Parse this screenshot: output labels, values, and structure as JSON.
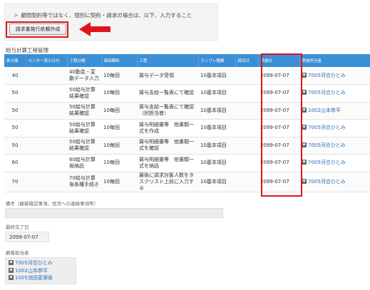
{
  "notice": {
    "text": "顧問契約等ではなく、個別に契約・請求の場合は、以下、入力すること",
    "button_label": "請求書発行依頼作成"
  },
  "section_title": "給与計算工程管理",
  "table": {
    "headers": [
      "表示順",
      "カンダー表示日付",
      "工程分類",
      "毎回類時",
      "工程",
      "テンプレ種類",
      "締切日",
      "実施日",
      "実施担当者"
    ],
    "rows": [
      {
        "order": "40",
        "calendar": "",
        "category": "40勤怠・変動データ入力",
        "frequency": "10毎回",
        "process": "賃与データ受領",
        "template": "10基本項目",
        "deadline": "",
        "done_date": "2099-07-07",
        "staff": "7005河合ひとみ"
      },
      {
        "order": "50",
        "calendar": "",
        "category": "50給与計算結果確認",
        "frequency": "10毎回",
        "process": "賃与支給一覧表にて確認",
        "template": "10基本項目",
        "deadline": "",
        "done_date": "2099-07-07",
        "staff": "7005河合ひとみ"
      },
      {
        "order": "50",
        "calendar": "",
        "category": "50給与計算結果確認",
        "frequency": "10毎回",
        "process": "賃与支給一覧表にて確認（別担当者）",
        "template": "10基本項目",
        "deadline": "",
        "done_date": "2099-07-07",
        "staff": "1002山本恭平"
      },
      {
        "order": "50",
        "calendar": "",
        "category": "50給与計算結果確認",
        "frequency": "10毎回",
        "process": "賃与明細書等　他書類一式を作成",
        "template": "10基本項目",
        "deadline": "",
        "done_date": "2099-07-07",
        "staff": "7005河合ひとみ"
      },
      {
        "order": "50",
        "calendar": "",
        "category": "50給与計算結果確認",
        "frequency": "10毎回",
        "process": "賃与明細書等　他書類一式を確認",
        "template": "10基本項目",
        "deadline": "",
        "done_date": "2099-07-07",
        "staff": "7005河合ひとみ"
      },
      {
        "order": "60",
        "calendar": "",
        "category": "60給与計算後納品",
        "frequency": "10毎回",
        "process": "賃与明細書等　他書類一式を納品",
        "template": "10基本項目",
        "deadline": "",
        "done_date": "2099-07-07",
        "staff": "7005河合ひとみ"
      },
      {
        "order": "70",
        "calendar": "",
        "category": "70給与計算後各種手続き",
        "frequency": "10毎回",
        "process": "最後に請求対象人数をタスクリスト上段に入力する",
        "template": "10基本項目",
        "deadline": "",
        "done_date": "2099-07-07",
        "staff": "7005河合ひとみ"
      }
    ]
  },
  "remarks": {
    "label": "備考（顧客確認事項、翌月への連絡事項等）",
    "value": ""
  },
  "last_completed": {
    "label": "最終完了日",
    "value": "2099-07-07"
  },
  "customer_staff": {
    "label": "顧客担当者",
    "items": [
      "7005河合ひとみ",
      "1002山本恭平",
      "1005池田恵理香"
    ]
  },
  "icons": {
    "person": "person-icon",
    "arrow": "red-arrow-left-icon"
  },
  "colors": {
    "header_bg": "#3a8fd6",
    "highlight": "#e0141c",
    "link": "#2a6fb8"
  }
}
